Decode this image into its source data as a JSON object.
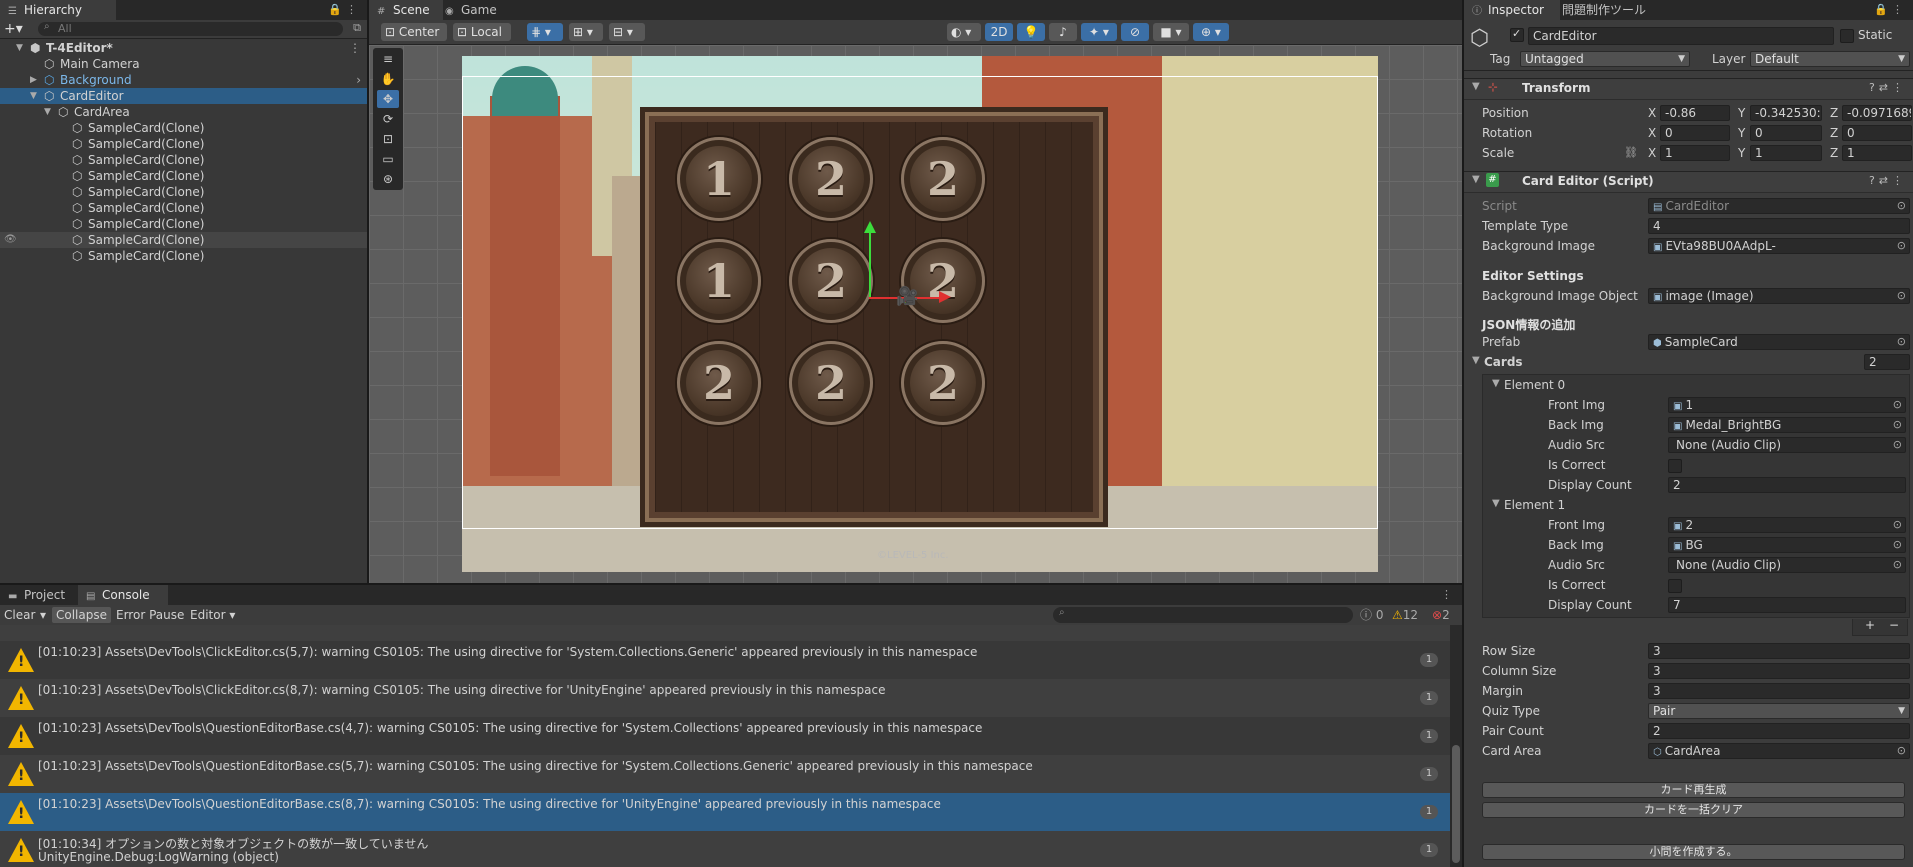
{
  "hierarchy": {
    "tab": "Hierarchy",
    "search_placeholder": "All",
    "items": [
      {
        "label": "T-4Editor*",
        "depth": 0,
        "expanded": true,
        "bold": true
      },
      {
        "label": "Main Camera",
        "depth": 1
      },
      {
        "label": "Background",
        "depth": 1,
        "prefab": true,
        "collapsed": true
      },
      {
        "label": "CardEditor",
        "depth": 1,
        "expanded": true,
        "selected": true
      },
      {
        "label": "CardArea",
        "depth": 2,
        "expanded": true
      },
      {
        "label": "SampleCard(Clone)",
        "depth": 3
      },
      {
        "label": "SampleCard(Clone)",
        "depth": 3
      },
      {
        "label": "SampleCard(Clone)",
        "depth": 3
      },
      {
        "label": "SampleCard(Clone)",
        "depth": 3
      },
      {
        "label": "SampleCard(Clone)",
        "depth": 3
      },
      {
        "label": "SampleCard(Clone)",
        "depth": 3
      },
      {
        "label": "SampleCard(Clone)",
        "depth": 3
      },
      {
        "label": "SampleCard(Clone)",
        "depth": 3,
        "hover": true
      },
      {
        "label": "SampleCard(Clone)",
        "depth": 3
      }
    ]
  },
  "scene": {
    "tabs": [
      "Scene",
      "Game"
    ],
    "pivot": "Center",
    "space": "Local",
    "mode_2d": "2D",
    "board_medals": [
      "1",
      "2",
      "2",
      "1",
      "2",
      "2",
      "2",
      "2",
      "2"
    ],
    "copyright": "©LEVEL-5 Inc."
  },
  "inspector": {
    "tabs": [
      "Inspector",
      "問題制作ツール"
    ],
    "object_name": "CardEditor",
    "static_label": "Static",
    "tag_label": "Tag",
    "tag_value": "Untagged",
    "layer_label": "Layer",
    "layer_value": "Default",
    "transform": {
      "title": "Transform",
      "position_label": "Position",
      "rotation_label": "Rotation",
      "scale_label": "Scale",
      "position": {
        "x": "-0.86",
        "y": "-0.342530:",
        "z": "-0.0971689"
      },
      "rotation": {
        "x": "0",
        "y": "0",
        "z": "0"
      },
      "scale": {
        "x": "1",
        "y": "1",
        "z": "1"
      }
    },
    "script": {
      "title": "Card Editor (Script)",
      "script_label": "Script",
      "script_value": "CardEditor",
      "template_type_label": "Template Type",
      "template_type": "4",
      "background_image_label": "Background Image",
      "background_image": "EVta98BU0AAdpL-",
      "editor_settings": "Editor Settings",
      "bg_image_object_label": "Background Image Object",
      "bg_image_object": "image (Image)",
      "json_section": "JSON情報の追加",
      "prefab_label": "Prefab",
      "prefab": "SampleCard",
      "cards_label": "Cards",
      "cards_count": "2",
      "elements": [
        {
          "title": "Element 0",
          "front_img": "1",
          "back_img": "Medal_BrightBG",
          "audio_src": "None (Audio Clip)",
          "display_count": "2"
        },
        {
          "title": "Element 1",
          "front_img": "2",
          "back_img": "BG",
          "audio_src": "None (Audio Clip)",
          "display_count": "7"
        }
      ],
      "front_img_label": "Front Img",
      "back_img_label": "Back Img",
      "audio_src_label": "Audio Src",
      "is_correct_label": "Is Correct",
      "display_count_label": "Display Count",
      "row_size_label": "Row Size",
      "row_size": "3",
      "column_size_label": "Column Size",
      "column_size": "3",
      "margin_label": "Margin",
      "margin": "3",
      "quiz_type_label": "Quiz Type",
      "quiz_type": "Pair",
      "pair_count_label": "Pair Count",
      "pair_count": "2",
      "card_area_label": "Card Area",
      "card_area": "CardArea",
      "btn_regenerate": "カード再生成",
      "btn_clear": "カードを一括クリア",
      "btn_create": "小問を作成する。"
    }
  },
  "console": {
    "tabs": [
      "Project",
      "Console"
    ],
    "clear": "Clear",
    "collapse": "Collapse",
    "error_pause": "Error Pause",
    "editor": "Editor",
    "count_info": "0",
    "count_warn": "12",
    "count_error": "2",
    "rows": [
      {
        "msg": "[01:10:23] Assets\\DevTools\\ClickEditor.cs(5,7): warning CS0105: The using directive for 'System.Collections.Generic' appeared previously in this namespace",
        "count": "1"
      },
      {
        "msg": "[01:10:23] Assets\\DevTools\\ClickEditor.cs(8,7): warning CS0105: The using directive for 'UnityEngine' appeared previously in this namespace",
        "count": "1"
      },
      {
        "msg": "[01:10:23] Assets\\DevTools\\QuestionEditorBase.cs(4,7): warning CS0105: The using directive for 'System.Collections' appeared previously in this namespace",
        "count": "1"
      },
      {
        "msg": "[01:10:23] Assets\\DevTools\\QuestionEditorBase.cs(5,7): warning CS0105: The using directive for 'System.Collections.Generic' appeared previously in this namespace",
        "count": "1"
      },
      {
        "msg": "[01:10:23] Assets\\DevTools\\QuestionEditorBase.cs(8,7): warning CS0105: The using directive for 'UnityEngine' appeared previously in this namespace",
        "count": "1",
        "selected": true
      },
      {
        "msg": "[01:10:34] オプションの数と対象オブジェクトの数が一致していません",
        "msg2": "UnityEngine.Debug:LogWarning (object)",
        "count": "1"
      }
    ]
  }
}
